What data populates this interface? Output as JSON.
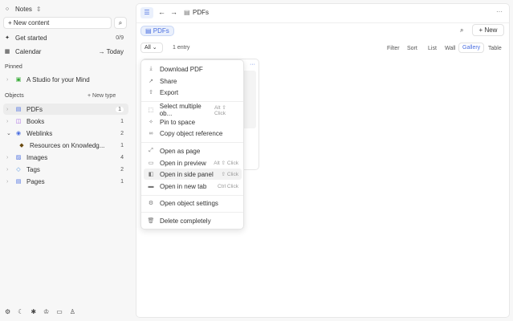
{
  "sidebar": {
    "space": "Notes",
    "new_content": "+ New content",
    "get_started": "Get started",
    "get_started_count": "0/9",
    "calendar": "Calendar",
    "today": "→ Today",
    "pinned_label": "Pinned",
    "pinned": [
      {
        "label": "A Studio for your Mind"
      }
    ],
    "objects_label": "Objects",
    "new_type": "+ New type",
    "objects": [
      {
        "label": "PDFs",
        "count": "1",
        "color": "#4a6ee0"
      },
      {
        "label": "Books",
        "count": "1",
        "color": "#a05ee0"
      },
      {
        "label": "Weblinks",
        "count": "2",
        "color": "#4a6ee0"
      },
      {
        "label": "Resources on Knowledg...",
        "count": "1"
      },
      {
        "label": "Images",
        "count": "4",
        "color": "#4a6ee0"
      },
      {
        "label": "Tags",
        "count": "2",
        "color": "#4a8ee0"
      },
      {
        "label": "Pages",
        "count": "1",
        "color": "#4a6ee0"
      }
    ]
  },
  "header": {
    "breadcrumb": "PDFs",
    "more": "···"
  },
  "toolbar": {
    "type_chip": "PDFs",
    "new": "+ New",
    "filter_all": "All",
    "entries": "1 entry",
    "views": [
      "Filter",
      "Sort",
      "List",
      "Wall",
      "Gallery",
      "Table"
    ],
    "active_view": "Gallery"
  },
  "menu": {
    "items": [
      {
        "label": "Download PDF",
        "icon": "download-icon"
      },
      {
        "label": "Share",
        "icon": "share-icon"
      },
      {
        "label": "Export",
        "icon": "export-icon"
      },
      {
        "label": "Select multiple ob...",
        "shortcut": "Alt ⇧ Click",
        "icon": "select-icon"
      },
      {
        "label": "Pin to space",
        "icon": "pin-icon"
      },
      {
        "label": "Copy object reference",
        "icon": "link-icon"
      },
      {
        "label": "Open as page",
        "icon": "expand-icon"
      },
      {
        "label": "Open in preview",
        "shortcut": "Alt ⇧ Click",
        "icon": "preview-icon"
      },
      {
        "label": "Open in side panel",
        "shortcut": "⇧ Click",
        "icon": "side-panel-icon"
      },
      {
        "label": "Open in new tab",
        "shortcut": "Ctrl Click",
        "icon": "new-tab-icon"
      },
      {
        "label": "Open object settings",
        "icon": "settings-icon"
      },
      {
        "label": "Delete completely",
        "icon": "trash-icon"
      }
    ]
  },
  "card": {
    "more": "···"
  }
}
